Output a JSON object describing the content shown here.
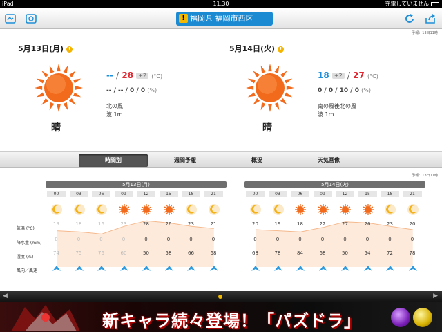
{
  "statusbar": {
    "device": "iPad",
    "time": "11:30",
    "charging": "充電していません"
  },
  "navbar": {
    "title": "福岡県 福岡市西区",
    "warning_mark": "!",
    "left_icons": [
      "map-icon",
      "settings-icon"
    ],
    "right_icons": [
      "refresh-icon",
      "share-icon"
    ]
  },
  "forecast_note": "予報：13日11時",
  "days": [
    {
      "date": "5月13日(月)",
      "condition": "晴",
      "low": "--",
      "high": "28",
      "delta": "+2",
      "unit": "(°C)",
      "precip": "-- / -- / 0 / 0",
      "precip_unit": "(%)",
      "wind": "北の風",
      "wave": "波 1m",
      "info_mark": "!"
    },
    {
      "date": "5月14日(火)",
      "condition": "晴",
      "low": "18",
      "high": "27",
      "delta": "+2",
      "unit": "(°C)",
      "precip": "0 / 0 / 10 / 0",
      "precip_unit": "(%)",
      "wind": "南の風後北の風",
      "wave": "波 1m",
      "info_mark": "!"
    }
  ],
  "tabs": [
    {
      "label": "時間別",
      "active": true
    },
    {
      "label": "週間予報",
      "active": false
    },
    {
      "label": "概況",
      "active": false
    },
    {
      "label": "天気画像",
      "active": false
    }
  ],
  "hourly_note": "予報：13日11時",
  "row_labels": [
    "気温 (°C)",
    "降水量 (mm)",
    "湿度 (%)",
    "風向／風速"
  ],
  "hourly": [
    {
      "date": "5月13日(月)",
      "hours": [
        "00",
        "03",
        "06",
        "09",
        "12",
        "15",
        "18",
        "21"
      ],
      "icons": [
        "moon",
        "moon",
        "moon",
        "sun",
        "sun",
        "sun",
        "moon",
        "moon"
      ],
      "temps": [
        "19",
        "18",
        "16",
        "23",
        "28",
        "26",
        "23",
        "21"
      ],
      "past": [
        true,
        true,
        true,
        true,
        false,
        false,
        false,
        false
      ],
      "rain": [
        "0",
        "0",
        "0",
        "0",
        "0",
        "0",
        "0",
        "0"
      ],
      "humidity": [
        "74",
        "75",
        "76",
        "60",
        "50",
        "58",
        "66",
        "68"
      ]
    },
    {
      "date": "5月14日(火)",
      "hours": [
        "00",
        "03",
        "06",
        "09",
        "12",
        "15",
        "18",
        "21"
      ],
      "icons": [
        "moon",
        "moon",
        "sun",
        "sun",
        "sun",
        "sun",
        "moon",
        "moon"
      ],
      "temps": [
        "20",
        "19",
        "18",
        "22",
        "27",
        "26",
        "23",
        "20"
      ],
      "past": [
        false,
        false,
        false,
        false,
        false,
        false,
        false,
        false
      ],
      "rain": [
        "0",
        "0",
        "0",
        "0",
        "0",
        "0",
        "0",
        "0"
      ],
      "humidity": [
        "68",
        "78",
        "84",
        "68",
        "50",
        "54",
        "72",
        "78"
      ]
    }
  ],
  "ad": {
    "text": "新キャラ続々登場！「パズドラ」"
  },
  "colors": {
    "accent": "#1b8ad3",
    "high": "#e0262f",
    "low": "#1e8fd8",
    "sun": "#f26a1b"
  }
}
